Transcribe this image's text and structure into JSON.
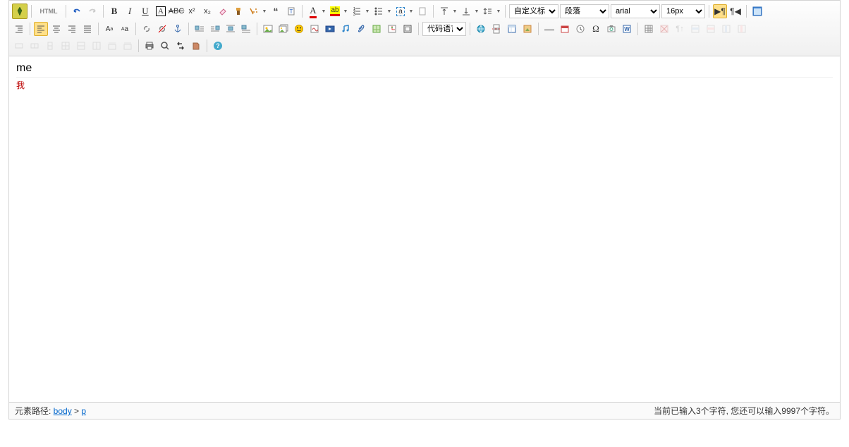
{
  "toolbar": {
    "html_label": "HTML",
    "custom_title": "自定义标题",
    "paragraph": "段落",
    "font_family": "arial",
    "font_size": "16px",
    "code_lang": "代码语言"
  },
  "content": {
    "line1": "me",
    "line2": "我"
  },
  "status": {
    "path_label": "元素路径: ",
    "path_body": "body",
    "path_sep": " > ",
    "path_p": "p",
    "char_count": "当前已输入3个字符, 您还可以输入9997个字符。"
  }
}
